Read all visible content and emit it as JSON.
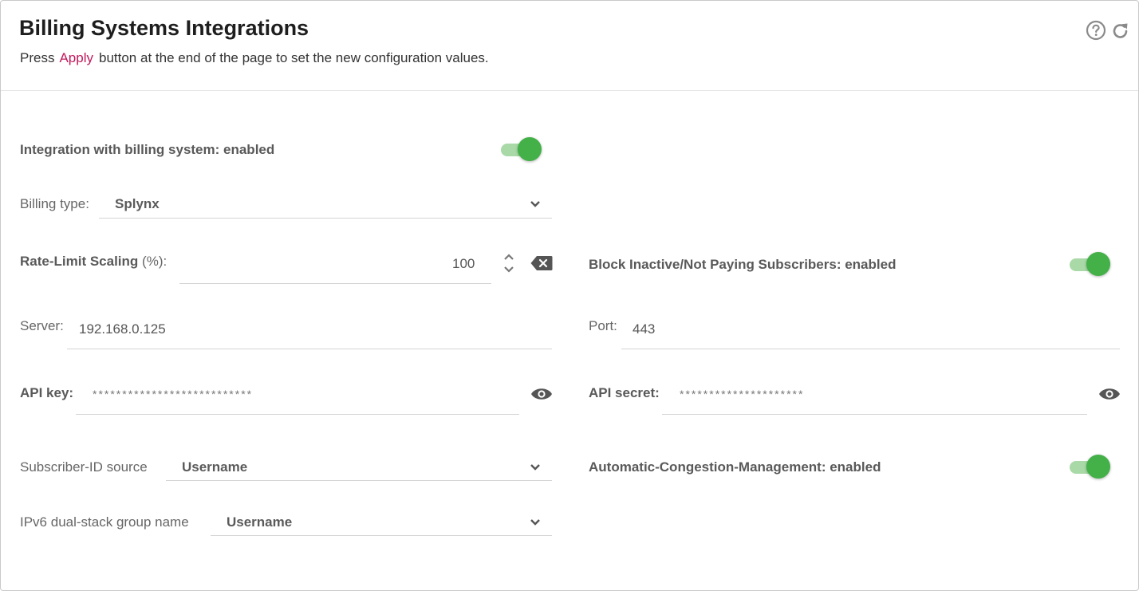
{
  "header": {
    "title": "Billing Systems Integrations",
    "subtitle_pre": "Press",
    "subtitle_link": "Apply",
    "subtitle_post": "button at the end of the page to set the new configuration values.",
    "icons": [
      "help-circle-icon",
      "refresh-icon"
    ]
  },
  "integration": {
    "label": "Integration with billing system: enabled",
    "enabled": true
  },
  "billing_type": {
    "label": "Billing type:",
    "value": "Splynx"
  },
  "rate_limit": {
    "label_bold": "Rate-Limit Scaling",
    "label_rest": " (%):",
    "value": "100"
  },
  "block_inactive": {
    "label": "Block Inactive/Not Paying Subscribers: enabled",
    "enabled": true
  },
  "server": {
    "label": "Server:",
    "value": "192.168.0.125"
  },
  "port": {
    "label": "Port:",
    "value": "443"
  },
  "api_key": {
    "label": "API key:",
    "masked": "***************************"
  },
  "api_secret": {
    "label": "API secret:",
    "masked": "*********************"
  },
  "subscriber_id": {
    "label": "Subscriber-ID source",
    "value": "Username"
  },
  "congestion": {
    "label": "Automatic-Congestion-Management: enabled",
    "enabled": true
  },
  "ipv6_group": {
    "label": "IPv6 dual-stack group name",
    "value": "Username"
  },
  "colors": {
    "accent": "#43b048",
    "track": "#a8d9a6",
    "link": "#c2185b"
  }
}
